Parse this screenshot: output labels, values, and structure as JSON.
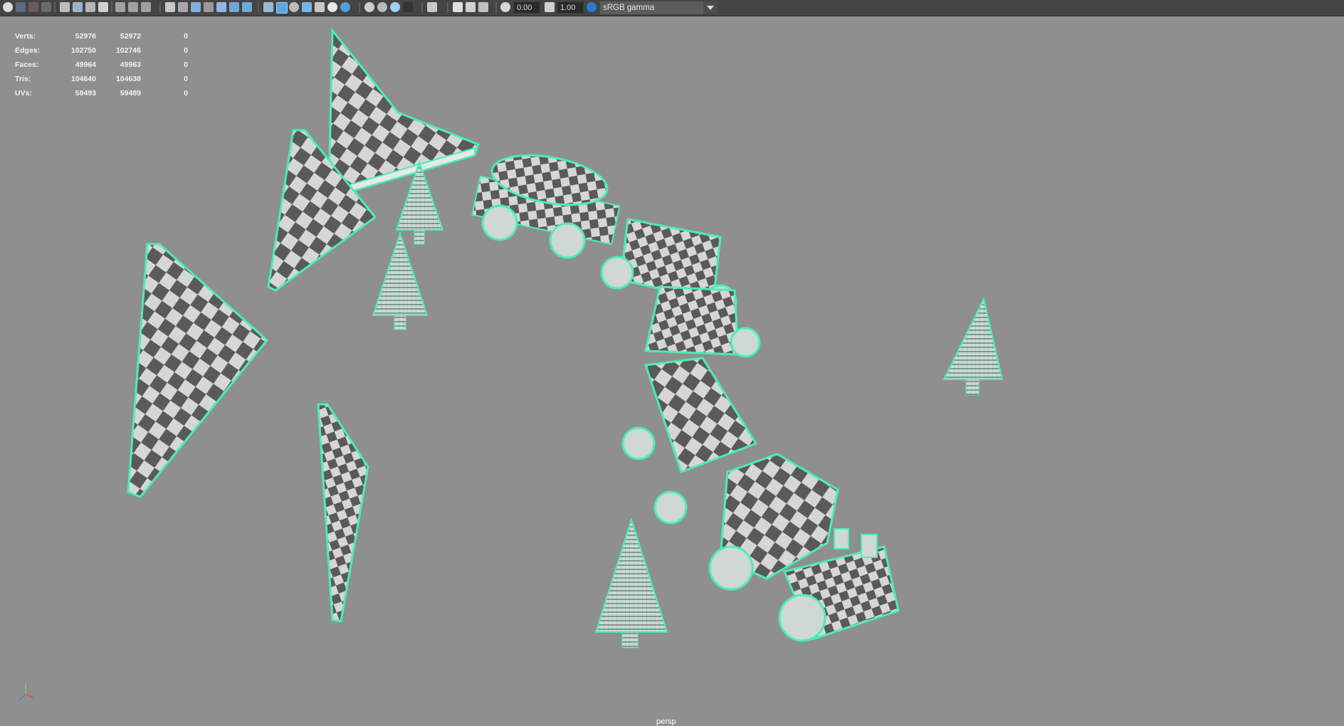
{
  "toolbar": {
    "exposure": "0.00",
    "gamma": "1.00",
    "color_space": "sRGB gamma"
  },
  "hud": {
    "rows": [
      {
        "label": "Verts:",
        "a": "52976",
        "b": "52972",
        "c": "0"
      },
      {
        "label": "Edges:",
        "a": "102750",
        "b": "102746",
        "c": "0"
      },
      {
        "label": "Faces:",
        "a": "49964",
        "b": "49963",
        "c": "0"
      },
      {
        "label": "Tris:",
        "a": "104640",
        "b": "104638",
        "c": "0"
      },
      {
        "label": "UVs:",
        "a": "59493",
        "b": "59489",
        "c": "0"
      }
    ]
  },
  "viewport": {
    "camera": "persp",
    "wire_color": "#48f0b0",
    "background": "#8f8f8f"
  }
}
